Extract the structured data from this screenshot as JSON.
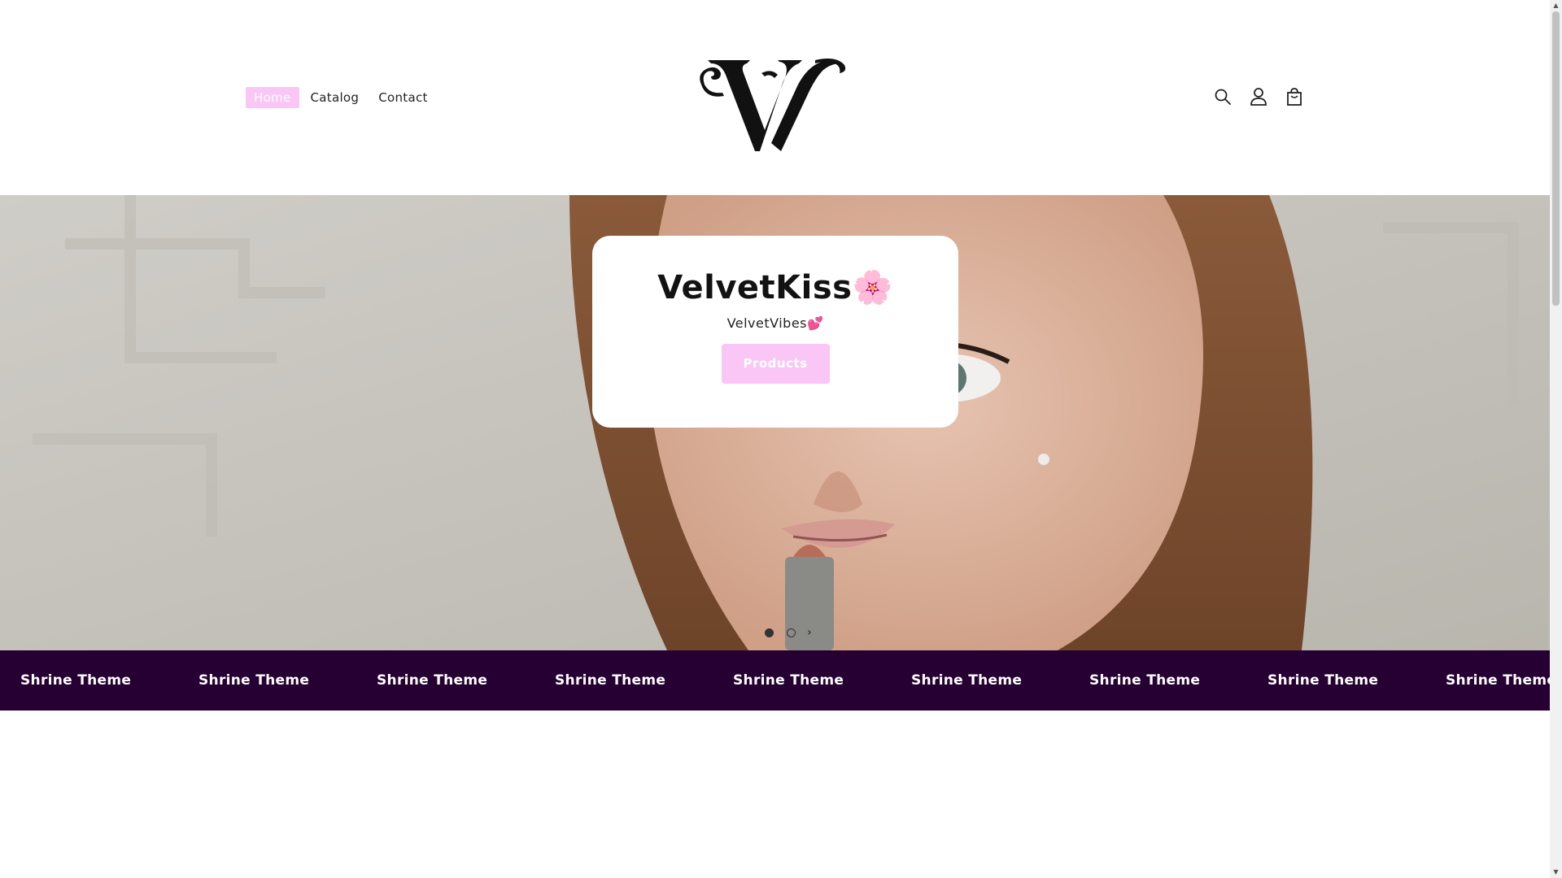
{
  "header": {
    "nav": [
      {
        "label": "Home",
        "active": true
      },
      {
        "label": "Catalog",
        "active": false
      },
      {
        "label": "Contact",
        "active": false
      }
    ],
    "icons": [
      "search-icon",
      "account-icon",
      "cart-icon"
    ]
  },
  "hero": {
    "title": "VelvetKiss🌸",
    "subtitle": "VelvetVibes💕",
    "button_label": "Products",
    "slides": 2,
    "active_slide": 1
  },
  "marquee": {
    "items": [
      "Shrine Theme",
      "Shrine Theme",
      "Shrine Theme",
      "Shrine Theme",
      "Shrine Theme",
      "Shrine Theme",
      "Shrine Theme",
      "Shrine Theme",
      "Shrine Theme"
    ]
  },
  "colors": {
    "accent_pink": "#f9c6f5",
    "marquee_bg": "#260032",
    "text": "#121212"
  }
}
